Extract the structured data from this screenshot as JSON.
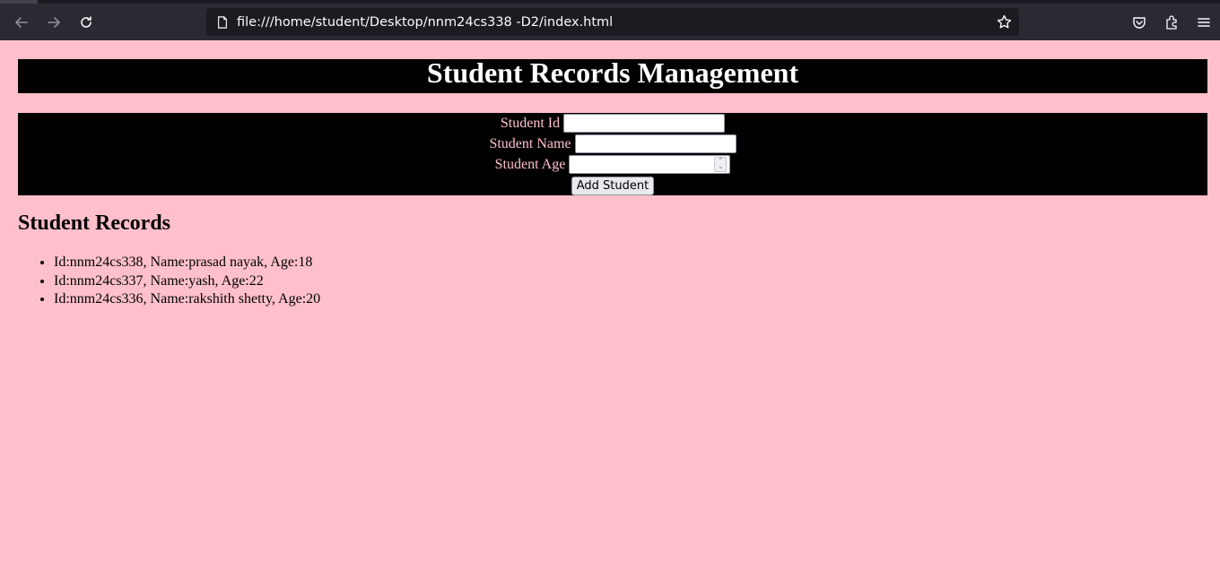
{
  "browser": {
    "url": "file:///home/student/Desktop/nnm24cs338 -D2/index.html",
    "icons": [
      "back-icon",
      "forward-icon",
      "reload-icon",
      "page-icon",
      "bookmark-star-icon",
      "pocket-icon",
      "extensions-icon",
      "menu-icon"
    ]
  },
  "page": {
    "title": "Student Records Management",
    "form": {
      "id_label": "Student Id",
      "name_label": "Student Name",
      "age_label": "Student Age",
      "id_value": "",
      "name_value": "",
      "age_value": "",
      "add_button": "Add Student"
    },
    "records_heading": "Student Records",
    "records": [
      "Id:nnm24cs338, Name:prasad nayak, Age:18",
      "Id:nnm24cs337, Name:yash, Age:22",
      "Id:nnm24cs336, Name:rakshith shetty, Age:20"
    ]
  },
  "colors": {
    "page_background": "#ffc0cb",
    "panel_background": "#000000",
    "label_text": "#ffc0cb",
    "heading_text": "#ffffff"
  }
}
